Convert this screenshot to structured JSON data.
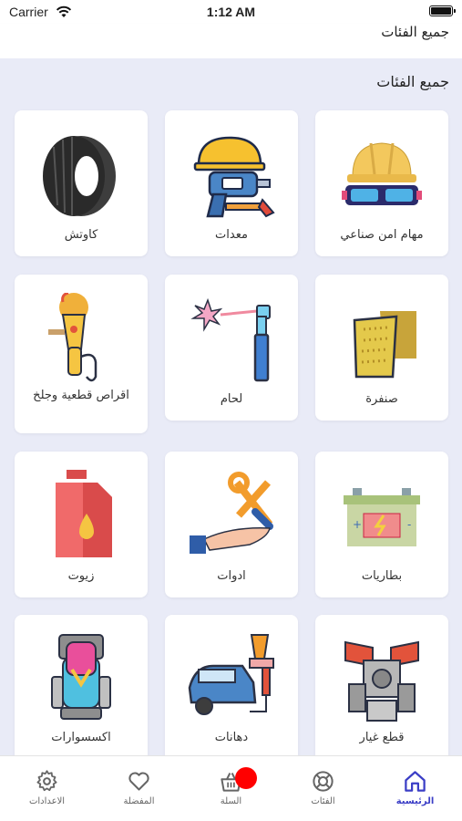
{
  "status_bar": {
    "carrier": "Carrier",
    "time": "1:12 AM"
  },
  "nav": {
    "title": "جميع الفئات"
  },
  "content": {
    "section_title": "جميع الفئات",
    "categories": [
      {
        "label": "مهام امن صناعي",
        "icon": "hard-hat-goggles-icon"
      },
      {
        "label": "معدات",
        "icon": "helmet-drill-icon"
      },
      {
        "label": "كاوتش",
        "icon": "tire-icon"
      },
      {
        "label": "صنفرة",
        "icon": "sandpaper-icon"
      },
      {
        "label": "لحام",
        "icon": "welding-torch-icon"
      },
      {
        "label": "اقراص قطعية وجلخ",
        "icon": "angle-grinder-icon"
      },
      {
        "label": "بطاريات",
        "icon": "battery-icon"
      },
      {
        "label": "ادوات",
        "icon": "tools-hand-icon"
      },
      {
        "label": "زيوت",
        "icon": "oil-can-icon"
      },
      {
        "label": "قطع غيار",
        "icon": "engine-parts-icon"
      },
      {
        "label": "دهانات",
        "icon": "spray-gun-car-icon"
      },
      {
        "label": "اكسسوارات",
        "icon": "car-seat-icon"
      }
    ]
  },
  "tabs": [
    {
      "label": "الرئيسية",
      "icon": "home-icon",
      "active": true
    },
    {
      "label": "الفئات",
      "icon": "lifebuoy-icon",
      "active": false
    },
    {
      "label": "السلة",
      "icon": "basket-icon",
      "active": false
    },
    {
      "label": "المفضلة",
      "icon": "heart-icon",
      "active": false
    },
    {
      "label": "الاعدادات",
      "icon": "gear-icon",
      "active": false
    }
  ],
  "colors": {
    "accent": "#3b3ec6",
    "background": "#e9ebf7",
    "badge": "#ff0000"
  }
}
